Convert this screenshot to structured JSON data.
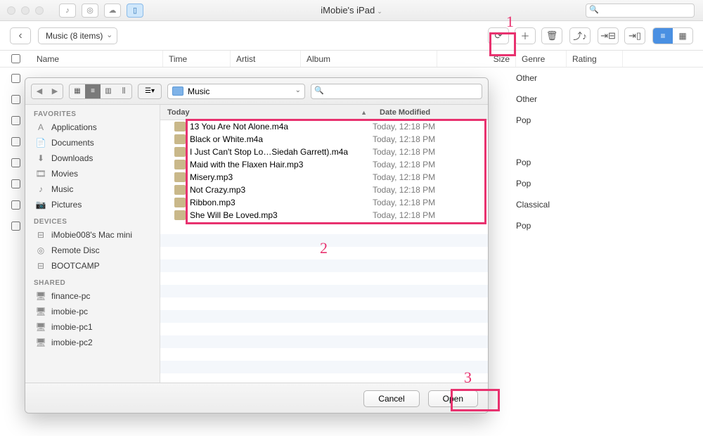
{
  "titlebar": {
    "title": "iMobie's iPad",
    "search_placeholder": ""
  },
  "toolbar": {
    "breadcrumb": "Music (8 items)"
  },
  "columns": {
    "name": "Name",
    "time": "Time",
    "artist": "Artist",
    "album": "Album",
    "size": "Size",
    "genre": "Genre",
    "rating": "Rating"
  },
  "bg_rows": [
    {
      "genre": "Other"
    },
    {
      "genre": "Other"
    },
    {
      "genre": "Pop"
    },
    {
      "genre": ""
    },
    {
      "genre": "Pop"
    },
    {
      "genre": "Pop"
    },
    {
      "genre": "Classical"
    },
    {
      "genre": "Pop"
    }
  ],
  "dialog": {
    "location": "Music",
    "search_placeholder": "",
    "sidebar": {
      "sections": [
        {
          "title": "FAVORITES",
          "items": [
            {
              "icon": "A",
              "label": "Applications"
            },
            {
              "icon": "📄",
              "label": "Documents"
            },
            {
              "icon": "⬇",
              "label": "Downloads"
            },
            {
              "icon": "🎞",
              "label": "Movies"
            },
            {
              "icon": "♪",
              "label": "Music"
            },
            {
              "icon": "📷",
              "label": "Pictures"
            }
          ]
        },
        {
          "title": "DEVICES",
          "items": [
            {
              "icon": "⊟",
              "label": "iMobie008's Mac mini"
            },
            {
              "icon": "◎",
              "label": "Remote Disc"
            },
            {
              "icon": "⊟",
              "label": "BOOTCAMP"
            }
          ]
        },
        {
          "title": "SHARED",
          "items": [
            {
              "icon": "🖥",
              "label": "finance-pc"
            },
            {
              "icon": "🖥",
              "label": "imobie-pc"
            },
            {
              "icon": "🖥",
              "label": "imobie-pc1"
            },
            {
              "icon": "🖥",
              "label": "imobie-pc2"
            }
          ]
        }
      ]
    },
    "file_header": {
      "col1": "Today",
      "col2": "Date Modified"
    },
    "files": [
      {
        "name": "13 You Are Not Alone.m4a",
        "date": "Today, 12:18 PM"
      },
      {
        "name": "Black or White.m4a",
        "date": "Today, 12:18 PM"
      },
      {
        "name": "I Just Can't Stop Lo…Siedah Garrett).m4a",
        "date": "Today, 12:18 PM"
      },
      {
        "name": "Maid with the Flaxen Hair.mp3",
        "date": "Today, 12:18 PM"
      },
      {
        "name": "Misery.mp3",
        "date": "Today, 12:18 PM"
      },
      {
        "name": "Not Crazy.mp3",
        "date": "Today, 12:18 PM"
      },
      {
        "name": "Ribbon.mp3",
        "date": "Today, 12:18 PM"
      },
      {
        "name": "She Will Be Loved.mp3",
        "date": "Today, 12:18 PM"
      }
    ],
    "buttons": {
      "cancel": "Cancel",
      "open": "Open"
    }
  },
  "annotations": {
    "n1": "1",
    "n2": "2",
    "n3": "3"
  }
}
